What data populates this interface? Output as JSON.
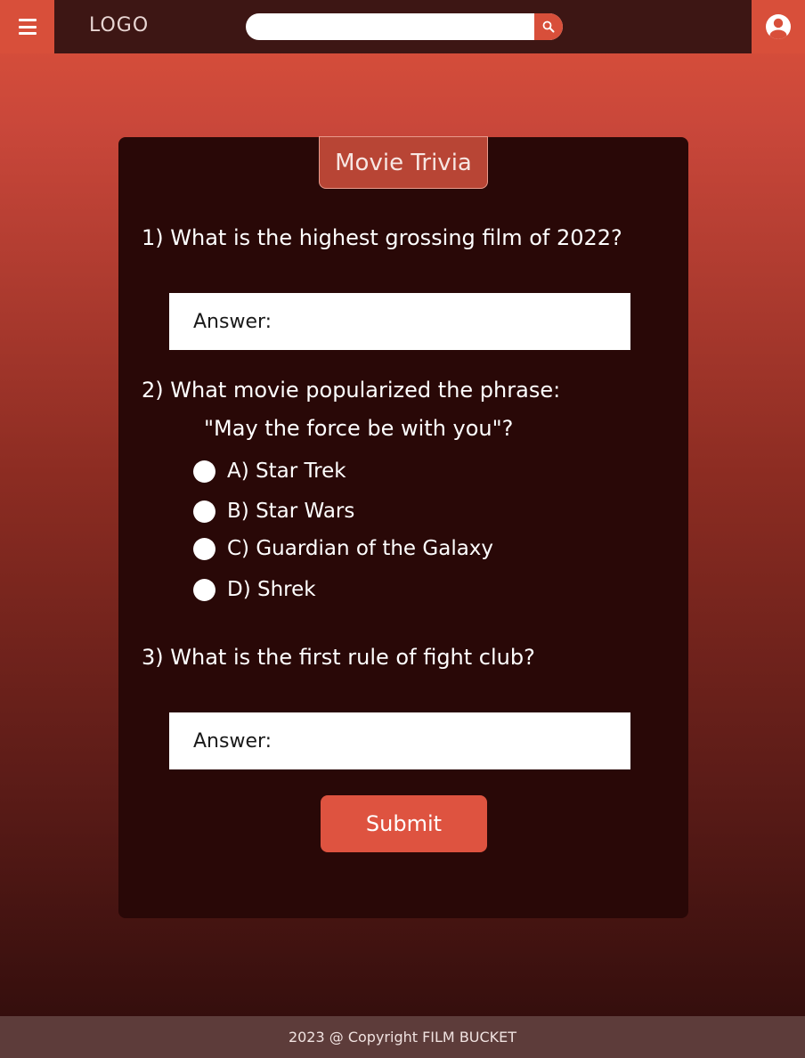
{
  "header": {
    "logo": "LOGO",
    "search_placeholder": "",
    "menu_icon": "hamburger-menu-icon",
    "search_icon": "search-icon",
    "account_icon": "user-account-icon"
  },
  "quiz": {
    "title": "Movie Trivia",
    "q1": {
      "text": "1) What is the highest grossing film of 2022?",
      "answer_placeholder": "Answer:"
    },
    "q2": {
      "text": "2) What movie popularized the phrase:",
      "quote": "\"May the force be with you\"?",
      "options": [
        "A) Star Trek",
        "B) Star Wars",
        "C) Guardian of the Galaxy",
        "D) Shrek"
      ]
    },
    "q3": {
      "text": "3) What is the first rule of fight club?",
      "answer_placeholder": "Answer:"
    },
    "submit_label": "Submit"
  },
  "footer": {
    "copyright": "2023 @ Copyright FILM BUCKET"
  },
  "colors": {
    "accent": "#d84f3a",
    "topbar": "#3d1614",
    "card": "#290807",
    "footer": "#5d3c3a"
  }
}
